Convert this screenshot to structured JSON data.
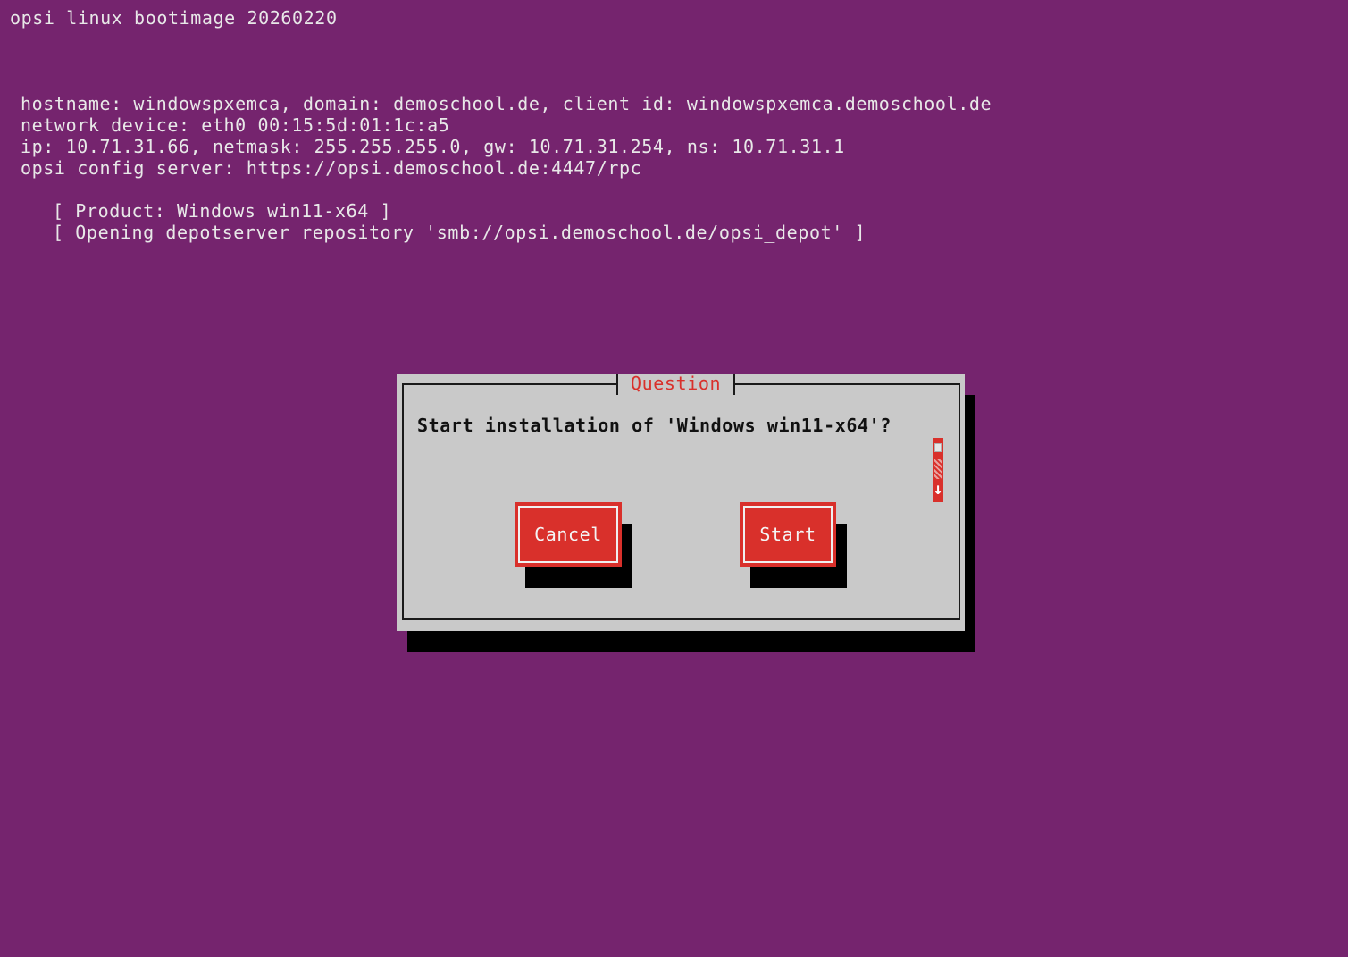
{
  "header": {
    "title": "opsi linux bootimage 20260220"
  },
  "client_info": {
    "line1": "hostname: windowspxemca, domain: demoschool.de, client id: windowspxemca.demoschool.de",
    "line2": "network device: eth0 00:15:5d:01:1c:a5",
    "line3": "ip: 10.71.31.66, netmask: 255.255.255.0, gw: 10.71.31.254, ns: 10.71.31.1",
    "line4": "opsi config server: https://opsi.demoschool.de:4447/rpc"
  },
  "status": {
    "line1": "[ Product: Windows win11-x64 ]",
    "line2": "[ Opening depotserver repository 'smb://opsi.demoschool.de/opsi_depot' ]"
  },
  "dialog": {
    "title": "Question",
    "message": "Start installation of 'Windows win11-x64'?",
    "scroll_arrow": "↓",
    "cancel_label": "Cancel",
    "start_label": "Start"
  },
  "colors": {
    "background": "#75246e",
    "dialog_bg": "#c9c9c9",
    "accent_red": "#d9302b"
  }
}
